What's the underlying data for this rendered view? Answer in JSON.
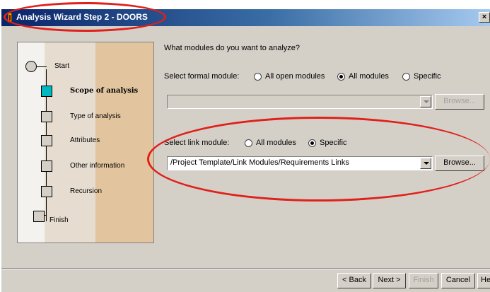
{
  "window": {
    "title": "Analysis Wizard  Step 2 - DOORS",
    "close_glyph": "×"
  },
  "steps": {
    "start": "Start",
    "scope": "Scope of analysis",
    "type": "Type of analysis",
    "attributes": "Attributes",
    "other": "Other information",
    "recursion": "Recursion",
    "finish": "Finish"
  },
  "main": {
    "question": "What modules do you want to analyze?",
    "formal": {
      "label": "Select formal module:",
      "options": [
        "All open modules",
        "All modules",
        "Specific"
      ],
      "selected": "All modules",
      "value": "",
      "browse": "Browse..."
    },
    "link": {
      "label": "Select link module:",
      "options": [
        "All modules",
        "Specific"
      ],
      "selected": "Specific",
      "value": "/Project Template/Link Modules/Requirements Links",
      "browse": "Browse..."
    }
  },
  "footer": {
    "back": "< Back",
    "next": "Next >",
    "finish": "Finish",
    "cancel": "Cancel",
    "help": "Help"
  },
  "colors": {
    "annotation": "#e0201a",
    "active_step": "#00b8c0",
    "titlebar": "#0a246a"
  }
}
